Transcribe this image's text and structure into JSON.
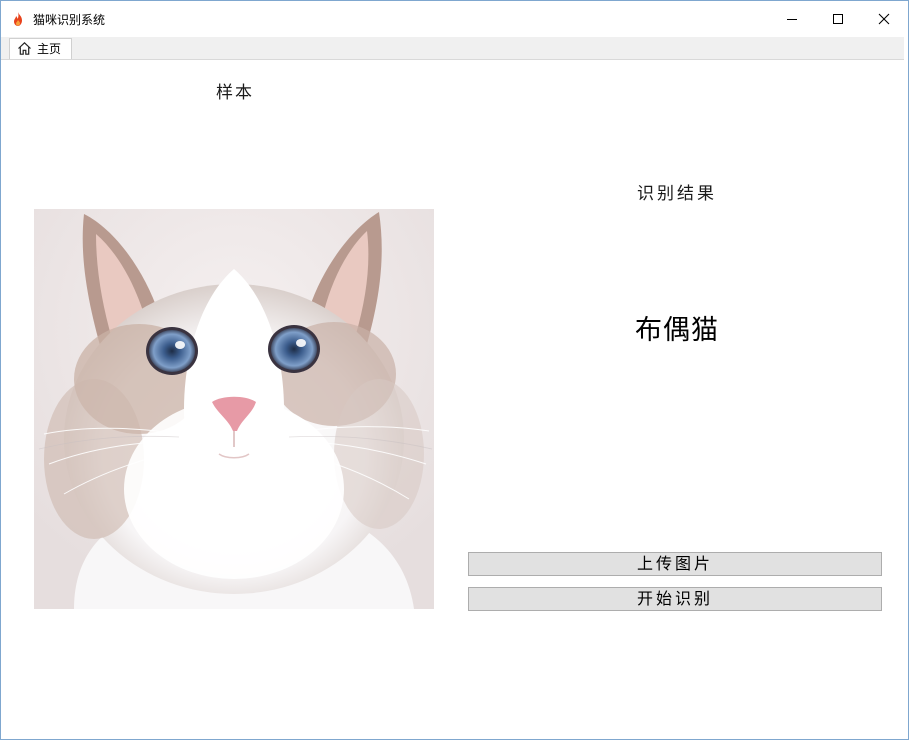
{
  "window": {
    "title": "猫咪识别系统",
    "icon": "flame-icon",
    "controls": [
      "minimize-icon",
      "maximize-icon",
      "close-icon"
    ]
  },
  "tabs": [
    {
      "label": "主页",
      "icon": "home-icon",
      "active": true
    }
  ],
  "main": {
    "sample_label": "样本",
    "result_title": "识别结果",
    "result_value": "布偶猫",
    "upload_button": "上传图片",
    "start_button": "开始识别"
  },
  "colors": {
    "window_border": "#7fa7cf",
    "tabbar_bg": "#f0f0f0",
    "button_bg": "#e1e1e1",
    "button_border": "#adadad",
    "flame": "#e8431c"
  }
}
